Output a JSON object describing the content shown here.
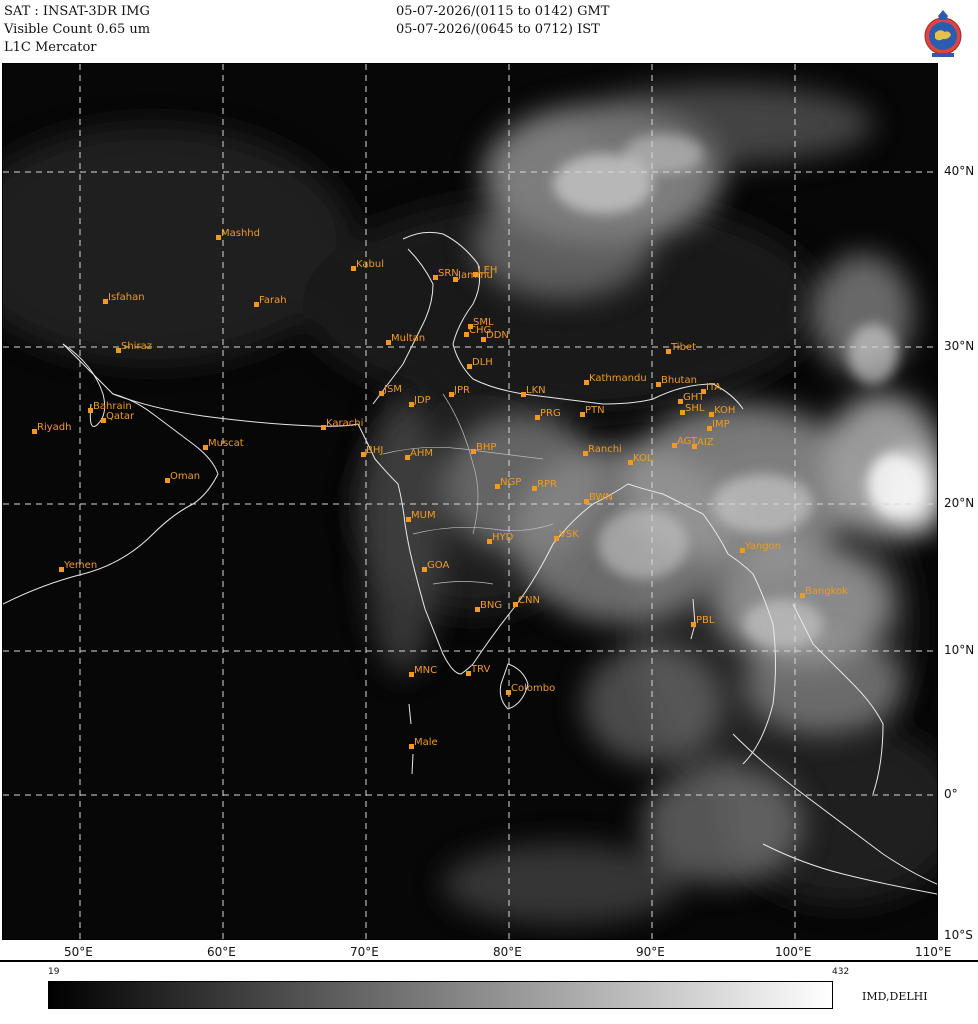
{
  "header": {
    "satellite": "SAT : INSAT-3DR IMG",
    "channel": "Visible Count 0.65 um",
    "projection": "L1C Mercator",
    "time_gmt": "05-07-2026/(0115 to 0142) GMT",
    "time_ist": "05-07-2026/(0645 to 0712) IST"
  },
  "logo": {
    "icon": "imd-emblem-icon"
  },
  "latitude_labels": [
    "40°N",
    "30°N",
    "20°N",
    "10°N",
    "0°",
    "10°S"
  ],
  "longitude_labels": [
    "50°E",
    "60°E",
    "70°E",
    "80°E",
    "90°E",
    "100°E",
    "110°E"
  ],
  "cities": [
    {
      "name": "Mashhd"
    },
    {
      "name": "Kabul"
    },
    {
      "name": "SRN"
    },
    {
      "name": "Jammu"
    },
    {
      "name": "LEH"
    },
    {
      "name": "Isfahan"
    },
    {
      "name": "Farah"
    },
    {
      "name": "SML"
    },
    {
      "name": "CHG"
    },
    {
      "name": "DDN"
    },
    {
      "name": "Multan"
    },
    {
      "name": "Shiraz"
    },
    {
      "name": "DLH"
    },
    {
      "name": "Tibet"
    },
    {
      "name": "Kathmandu"
    },
    {
      "name": "Bhutan"
    },
    {
      "name": "ITA"
    },
    {
      "name": "JSM"
    },
    {
      "name": "JDP"
    },
    {
      "name": "JPR"
    },
    {
      "name": "LKN"
    },
    {
      "name": "Bahrain"
    },
    {
      "name": "Qatar"
    },
    {
      "name": "Riyadh"
    },
    {
      "name": "Karachi"
    },
    {
      "name": "PRG"
    },
    {
      "name": "PTN"
    },
    {
      "name": "GHT"
    },
    {
      "name": "SHL"
    },
    {
      "name": "KOH"
    },
    {
      "name": "IMP"
    },
    {
      "name": "Muscat"
    },
    {
      "name": "BHJ"
    },
    {
      "name": "AHM"
    },
    {
      "name": "BHP"
    },
    {
      "name": "Ranchi"
    },
    {
      "name": "AGT"
    },
    {
      "name": "AIZ"
    },
    {
      "name": "KOL"
    },
    {
      "name": "Oman"
    },
    {
      "name": "NGP"
    },
    {
      "name": "RPR"
    },
    {
      "name": "BWN"
    },
    {
      "name": "MUM"
    },
    {
      "name": "HYD"
    },
    {
      "name": "VSK"
    },
    {
      "name": "Yangon"
    },
    {
      "name": "Yemen"
    },
    {
      "name": "GOA"
    },
    {
      "name": "BNG"
    },
    {
      "name": "CNN"
    },
    {
      "name": "Bangkok"
    },
    {
      "name": "PBL"
    },
    {
      "name": "MNC"
    },
    {
      "name": "TRV"
    },
    {
      "name": "Colombo"
    },
    {
      "name": "Male"
    }
  ],
  "colorbar": {
    "min": "19",
    "max": "432",
    "credit": "IMD,DELHI"
  }
}
